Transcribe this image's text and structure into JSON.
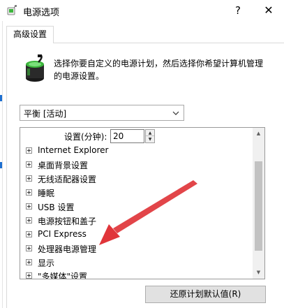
{
  "window": {
    "title": "电源选项",
    "help_label": "?",
    "close_label": "✕"
  },
  "tabs": [
    {
      "label": "高级设置",
      "selected": true
    }
  ],
  "description": "选择你要自定义的电源计划，然后选择你希望计算机管理的电源设置。",
  "plan_select": {
    "value": "平衡 [活动]"
  },
  "settings_row": {
    "label": "设置(分钟):",
    "value": "20"
  },
  "tree_items": [
    {
      "label": "Internet Explorer"
    },
    {
      "label": "桌面背景设置"
    },
    {
      "label": "无线适配器设置"
    },
    {
      "label": "睡眠"
    },
    {
      "label": "USB 设置"
    },
    {
      "label": "电源按钮和盖子"
    },
    {
      "label": "PCI Express"
    },
    {
      "label": "处理器电源管理"
    },
    {
      "label": "显示"
    },
    {
      "label": "\"多媒体\"设置"
    }
  ],
  "restore_button": {
    "label": "还原计划默认值(R)"
  },
  "colors": {
    "annotation_arrow": "#e0353a",
    "battery_green": "#3cb63c",
    "accent": "#1e6fd0"
  },
  "icons": {
    "title": "power-options-icon",
    "plan": "battery-icon",
    "annotation": "red-arrow"
  }
}
